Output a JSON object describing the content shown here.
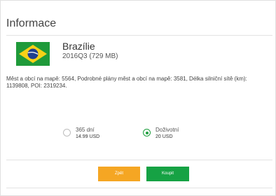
{
  "dialog": {
    "title": "Informace"
  },
  "map": {
    "flag_icon": "brazil-flag-icon",
    "country": "Brazílie",
    "version": "2016Q3 (729 MB)",
    "description": "Měst a obcí na mapě: 5564, Podrobné plány měst a obcí na mapě: 3581, Délka silniční sítě (km): 1139808, POI: 2319234."
  },
  "options": [
    {
      "name": "365 dní",
      "price": "14.99 USD",
      "selected": false
    },
    {
      "name": "Doživotní",
      "price": "20 USD",
      "selected": true
    }
  ],
  "buttons": {
    "back_label": "Zpět",
    "buy_label": "Koupit",
    "back_color": "#f5a623",
    "buy_color": "#16a244"
  },
  "colors": {
    "accent": "#1e9e3e"
  }
}
